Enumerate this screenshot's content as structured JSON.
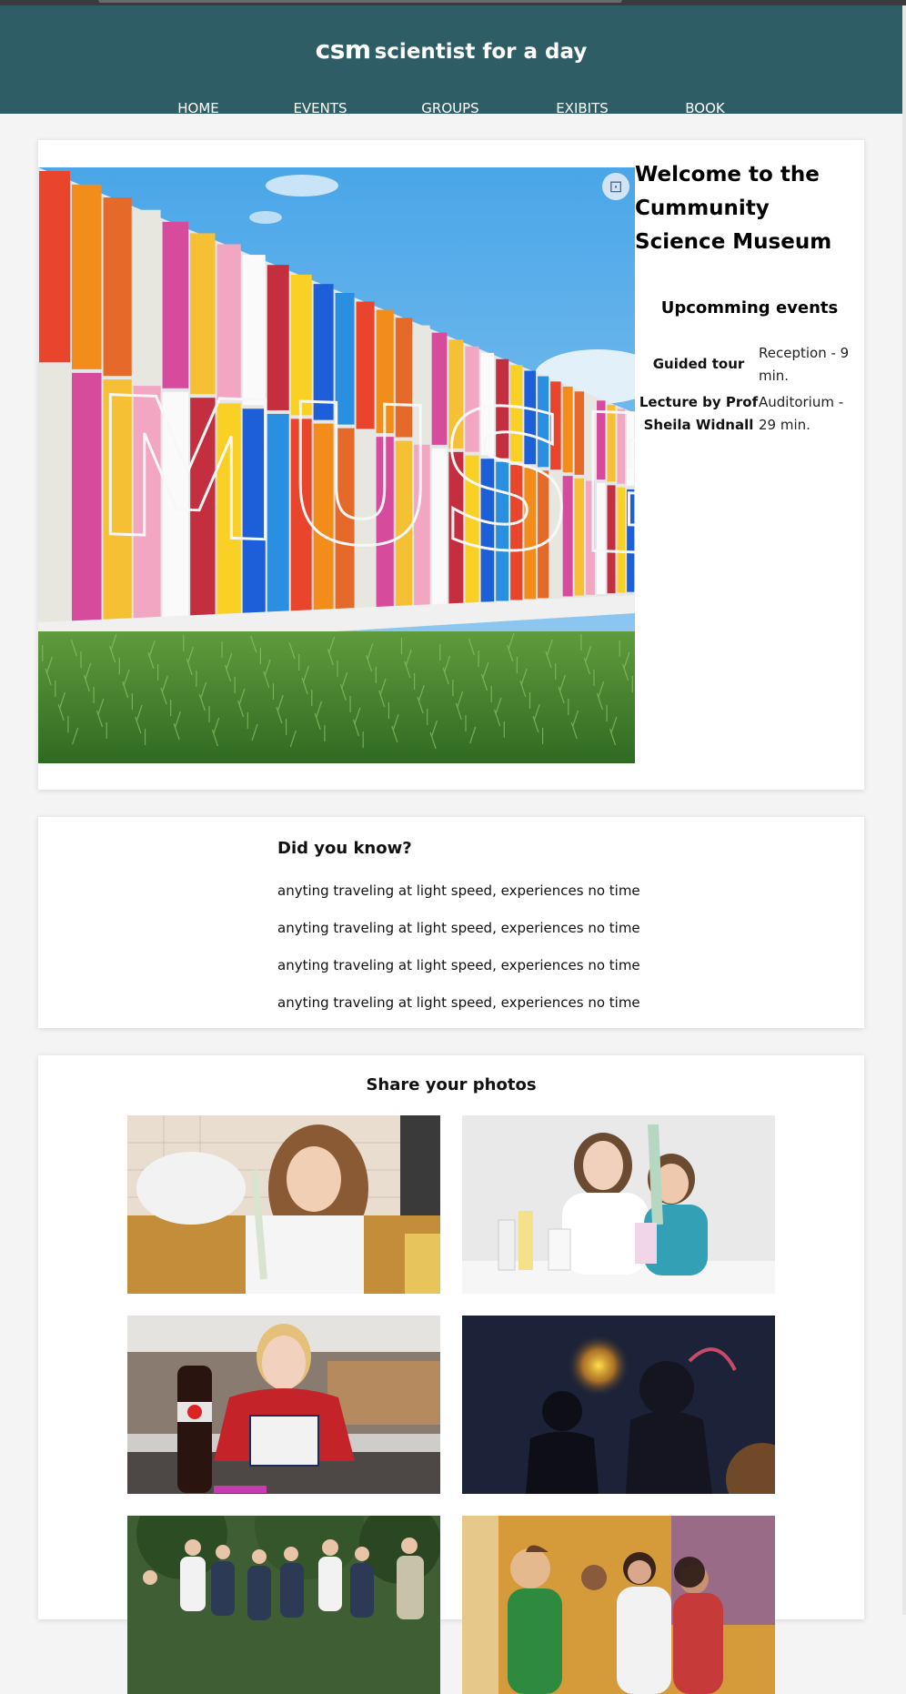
{
  "site": {
    "logo": "csm",
    "tagline": "scientist for a day"
  },
  "nav": {
    "items": [
      {
        "label": "HOME"
      },
      {
        "label": "EVENTS"
      },
      {
        "label": "GROUPS"
      },
      {
        "label": "EXIBITS"
      },
      {
        "label": "BOOK"
      }
    ]
  },
  "hero": {
    "image_text": "MUSEUM",
    "welcome": "Welcome to the Cummunity Science Museum",
    "lens_icon": "visual-search-icon"
  },
  "events": {
    "title": "Upcomming events",
    "items": [
      {
        "name": "Guided tour",
        "location": "Reception - 9 min."
      },
      {
        "name": "Lecture by Prof Sheila Widnall",
        "location": "Auditorium - 29 min."
      }
    ]
  },
  "did_you_know": {
    "title": "Did you know?",
    "facts": [
      "anyting traveling at light speed, experiences no time",
      "anyting traveling at light speed, experiences no time",
      "anyting traveling at light speed, experiences no time",
      "anyting traveling at light speed, experiences no time"
    ]
  },
  "share": {
    "title": "Share your photos",
    "photos": [
      {
        "label": "cola-bottle"
      }
    ]
  }
}
